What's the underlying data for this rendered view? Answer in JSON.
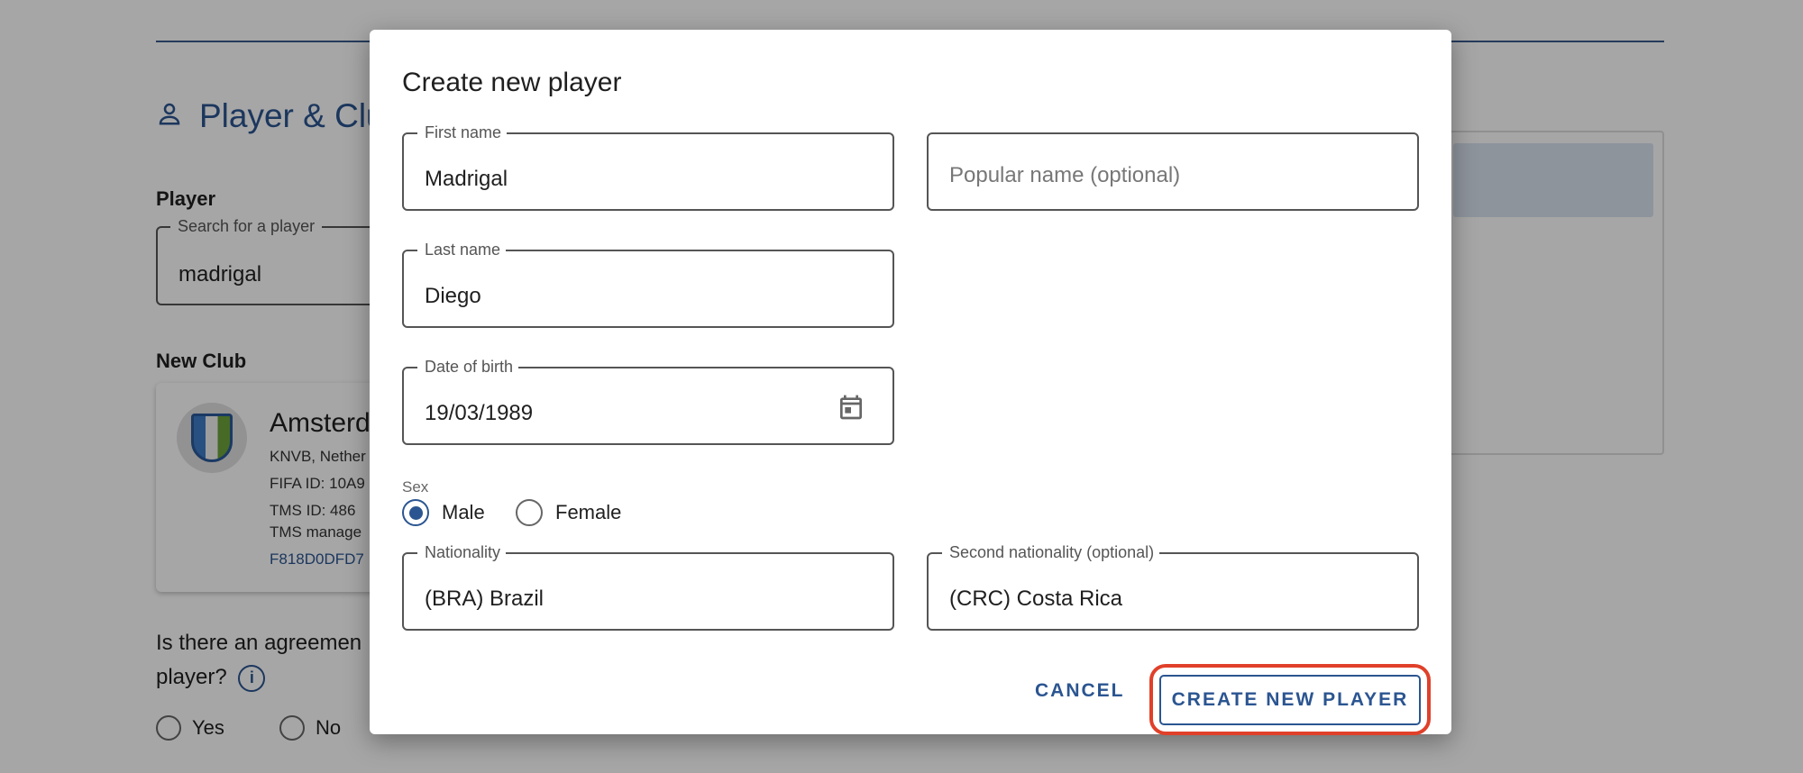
{
  "background": {
    "section_title": "Player & Clu",
    "player_label": "Player",
    "search_legend": "Search for a player",
    "search_value": "madrigal",
    "new_club_label": "New Club",
    "club_name": "Amsterd",
    "club_line1": "KNVB, Nether",
    "club_line2": "FIFA ID: 10A9",
    "club_line3": "TMS ID: 486",
    "club_line4": "TMS manage",
    "club_link": "F818D0DFD7",
    "question_line1": "Is there an agreemen",
    "question_line2": "player?",
    "info_glyph": "i",
    "yes_label": "Yes",
    "no_label": "No"
  },
  "dialog": {
    "title": "Create new player",
    "first_name": {
      "legend": "First name",
      "value": "Madrigal"
    },
    "popular_name": {
      "placeholder": "Popular name (optional)"
    },
    "last_name": {
      "legend": "Last name",
      "value": "Diego"
    },
    "date_of_birth": {
      "legend": "Date of birth",
      "value": "19/03/1989"
    },
    "sex": {
      "label": "Sex",
      "options": [
        "Male",
        "Female"
      ],
      "selected": "Male"
    },
    "nationality": {
      "legend": "Nationality",
      "value": "(BRA) Brazil"
    },
    "second_nationality": {
      "legend": "Second nationality (optional)",
      "value": "(CRC) Costa Rica"
    },
    "cancel_label": "CANCEL",
    "create_label": "CREATE NEW PLAYER"
  },
  "colors": {
    "accent": "#2b5591",
    "highlight": "#e0402a"
  }
}
